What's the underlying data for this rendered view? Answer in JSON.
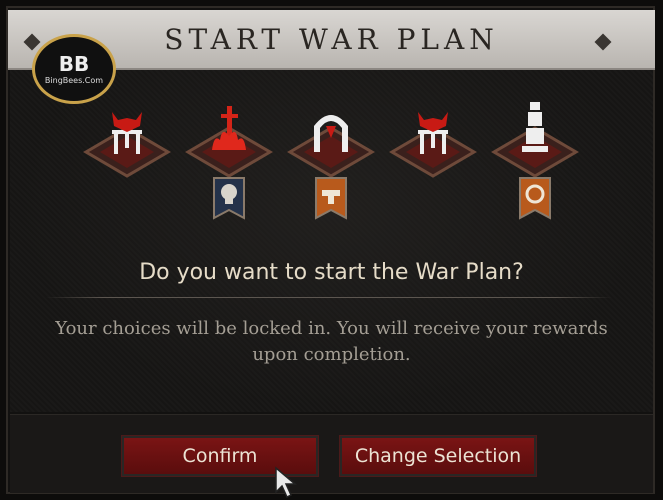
{
  "dialog": {
    "title": "START WAR PLAN",
    "question": "Do you want to start the War Plan?",
    "body": "Your choices will be locked in. You will receive your rewards upon completion."
  },
  "watermark": {
    "mark": "BB",
    "text": "BingBees.Com"
  },
  "plan_steps": [
    {
      "icon": "demon-gate-icon",
      "reward_icon": null
    },
    {
      "icon": "flame-sword-icon",
      "reward_icon": "skull-banner-icon"
    },
    {
      "icon": "arch-gate-icon",
      "reward_icon": "anvil-banner-icon"
    },
    {
      "icon": "demon-gate-icon",
      "reward_icon": null
    },
    {
      "icon": "tower-icon",
      "reward_icon": "ring-banner-icon"
    }
  ],
  "buttons": {
    "confirm_label": "Confirm",
    "change_label": "Change Selection"
  },
  "colors": {
    "accent_red": "#7a1414",
    "text_light": "#e6dcc8",
    "text_muted": "#a49e94"
  }
}
